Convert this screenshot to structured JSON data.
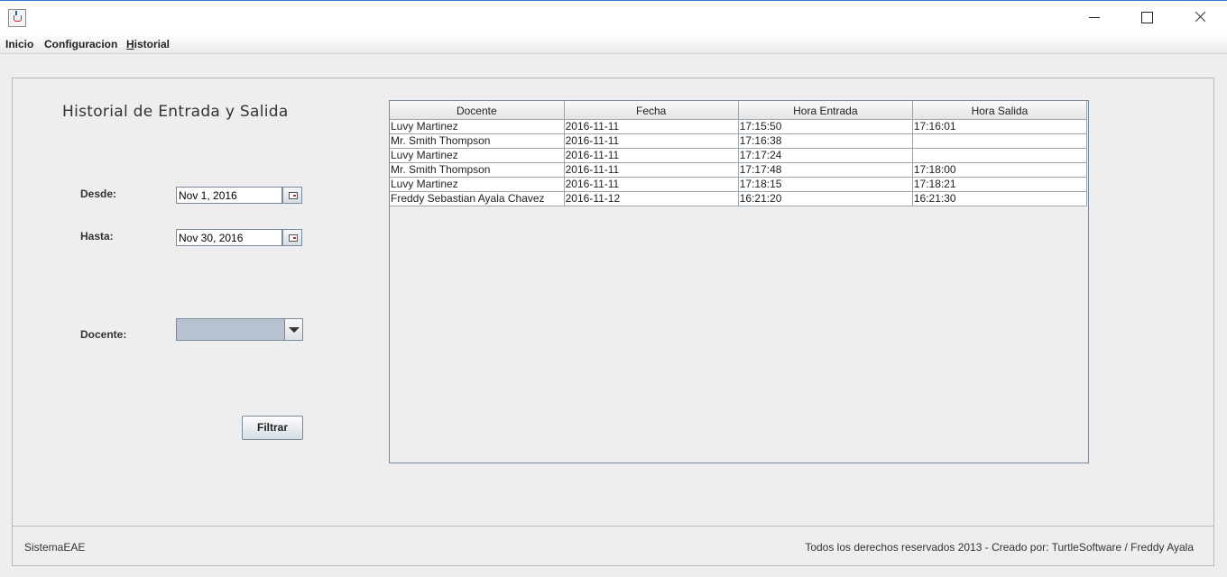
{
  "window": {
    "icon": "java-cup-icon"
  },
  "menu": {
    "items": [
      {
        "label": "Inicio"
      },
      {
        "label": "Configuracion"
      },
      {
        "label_first": "H",
        "label_rest": "istorial"
      }
    ]
  },
  "page": {
    "title": "Historial de Entrada y Salida"
  },
  "filters": {
    "desde_label": "Desde:",
    "desde_value": "Nov 1, 2016",
    "hasta_label": "Hasta:",
    "hasta_value": "Nov 30, 2016",
    "docente_label": "Docente:",
    "docente_value": "",
    "filter_button": "Filtrar"
  },
  "table": {
    "columns": [
      "Docente",
      "Fecha",
      "Hora Entrada",
      "Hora Salida"
    ],
    "rows": [
      [
        "Luvy Martinez",
        "2016-11-11",
        "17:15:50",
        "17:16:01"
      ],
      [
        "Mr. Smith Thompson",
        "2016-11-11",
        "17:16:38",
        ""
      ],
      [
        "Luvy Martinez",
        "2016-11-11",
        "17:17:24",
        ""
      ],
      [
        "Mr. Smith Thompson",
        "2016-11-11",
        "17:17:48",
        "17:18:00"
      ],
      [
        "Luvy Martinez",
        "2016-11-11",
        "17:18:15",
        "17:18:21"
      ],
      [
        "Freddy Sebastian Ayala Chavez",
        "2016-11-12",
        "16:21:20",
        "16:21:30"
      ]
    ]
  },
  "footer": {
    "left": "SistemaEAE",
    "right": "Todos los derechos reservados 2013 - Creado por: TurtleSoftware / Freddy Ayala"
  },
  "colors": {
    "accent": "#2b7bd4",
    "combo_fill": "#b7c3d1"
  }
}
